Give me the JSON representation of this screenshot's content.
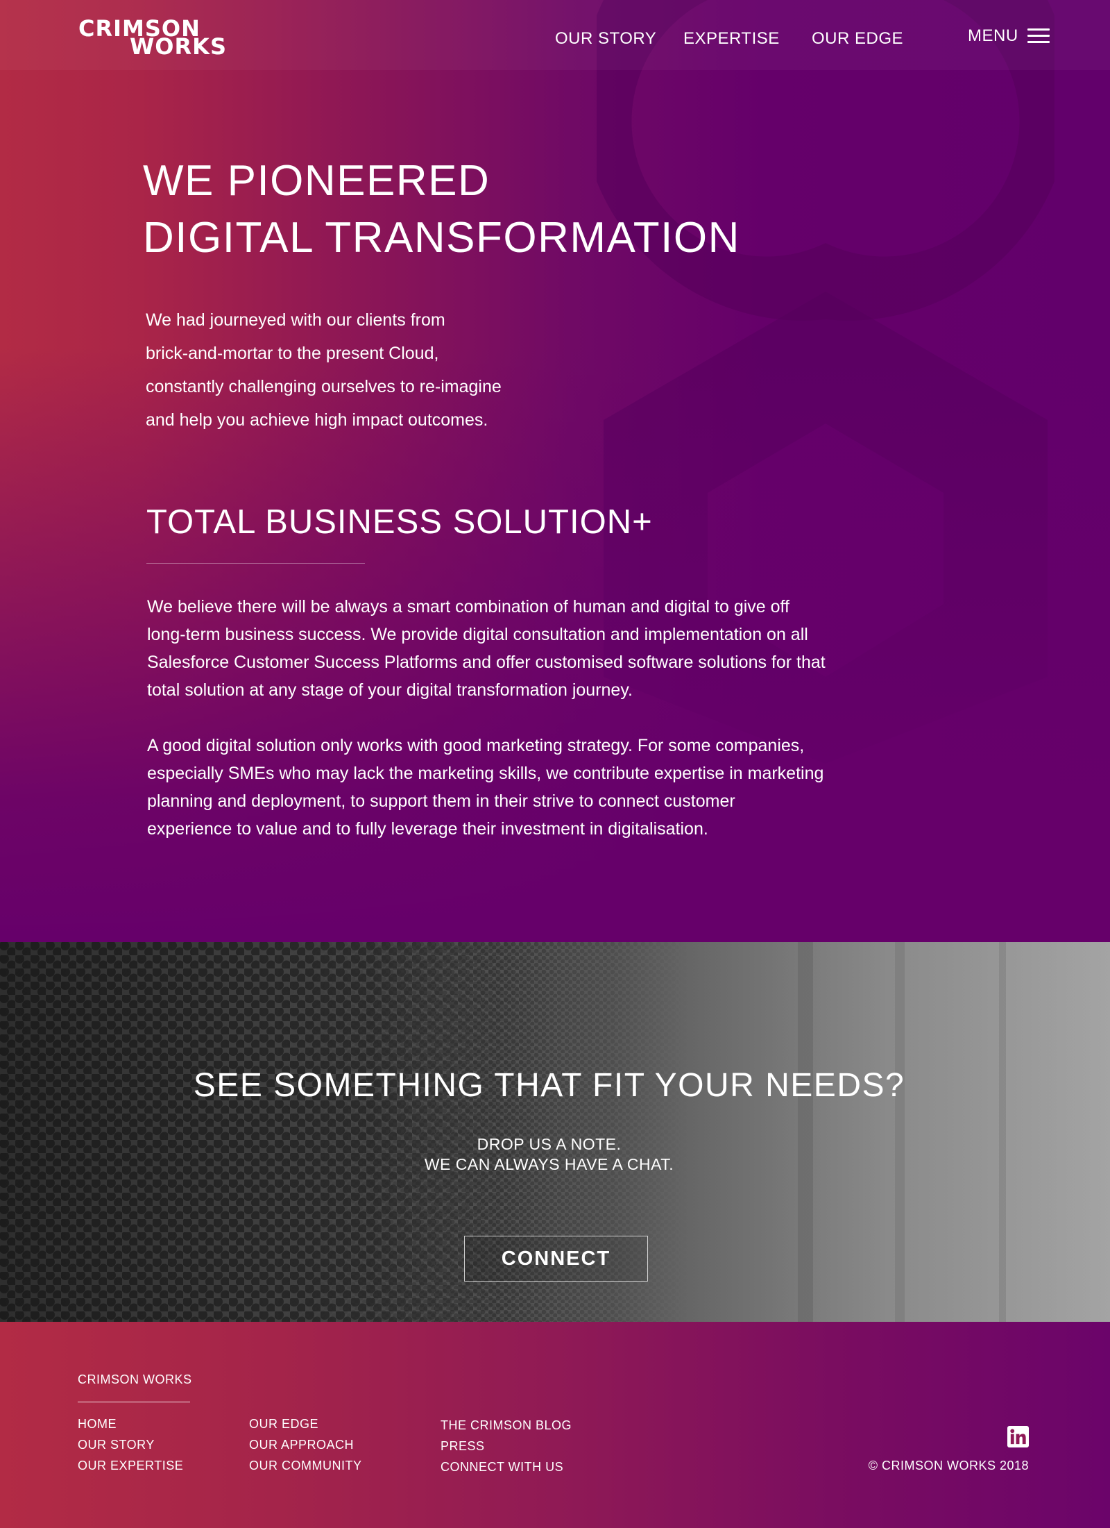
{
  "brand": {
    "logo_line1": "CRIMSON",
    "logo_line2": "WORKS",
    "colors": {
      "crimson": "#b22b45",
      "purple": "#66006a",
      "text": "#ffffff"
    }
  },
  "header": {
    "nav": [
      "OUR STORY",
      "EXPERTISE",
      "OUR EDGE"
    ],
    "menu_label": "MENU",
    "menu_icon": "hamburger-icon"
  },
  "hero": {
    "headline_line1": "WE PIONEERED",
    "headline_line2": "DIGITAL TRANSFORMATION",
    "intro_lines": [
      "We had journeyed with our clients from",
      "brick-and-mortar to the present Cloud,",
      "constantly challenging ourselves to re-imagine",
      "and help you achieve high impact outcomes."
    ]
  },
  "solution": {
    "heading": "TOTAL BUSINESS SOLUTION+",
    "paragraph1_lines": [
      "We believe there will be always a smart combination of human and digital to give off",
      "long-term business success. We provide digital consultation and implementation on all",
      "Salesforce Customer Success Platforms and offer customised software solutions for that",
      "total solution at any stage of your digital transformation journey."
    ],
    "paragraph2_lines": [
      "A good digital solution only works with good marketing strategy.  For some companies,",
      "especially SMEs who may lack the marketing skills, we contribute expertise in marketing",
      "planning and deployment, to support them in their strive to connect customer",
      "experience to value and to fully leverage their investment in digitalisation."
    ]
  },
  "cta": {
    "title": "SEE SOMETHING THAT FIT YOUR NEEDS?",
    "subtitle_line1": "DROP US A NOTE.",
    "subtitle_line2": "WE CAN ALWAYS HAVE A CHAT.",
    "button_label": "CONNECT"
  },
  "footer": {
    "brand": "CRIMSON WORKS",
    "col1": [
      "HOME",
      "OUR STORY",
      "OUR EXPERTISE"
    ],
    "col2": [
      "OUR EDGE",
      "OUR APPROACH",
      "OUR COMMUNITY"
    ],
    "col3": [
      "THE CRIMSON BLOG",
      "PRESS",
      "CONNECT WITH US"
    ],
    "social_icon": "linkedin-icon",
    "copyright": "© CRIMSON WORKS 2018"
  }
}
